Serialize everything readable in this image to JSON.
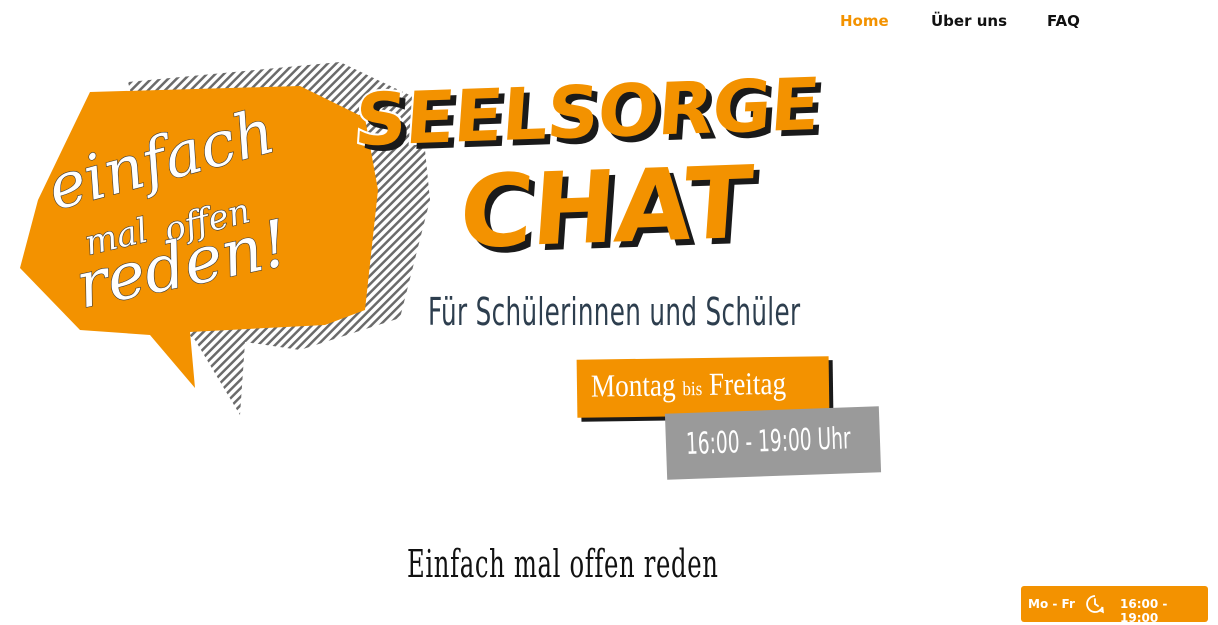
{
  "nav": {
    "items": [
      {
        "label": "Home",
        "active": true
      },
      {
        "label": "Über uns",
        "active": false
      },
      {
        "label": "FAQ",
        "active": false
      }
    ]
  },
  "hero": {
    "bubble_lines": [
      "einfach",
      "mal",
      "offen",
      "reden!"
    ],
    "brand_line1": "SEELSORGE",
    "brand_line2": "CHAT",
    "subtitle": "Für Schülerinnen und Schüler",
    "days_part1": "Montag",
    "days_part2": "bis",
    "days_part3": "Freitag",
    "time": "16:00 - 19:00 Uhr"
  },
  "section": {
    "heading": "Einfach mal offen reden"
  },
  "hours_badge": {
    "days": "Mo - Fr",
    "icon": "clock-icon",
    "time": "16:00 - 19:00"
  },
  "colors": {
    "accent": "#f39200",
    "dark_text": "#2d3e4e",
    "gray_box": "#9a9a9a"
  }
}
